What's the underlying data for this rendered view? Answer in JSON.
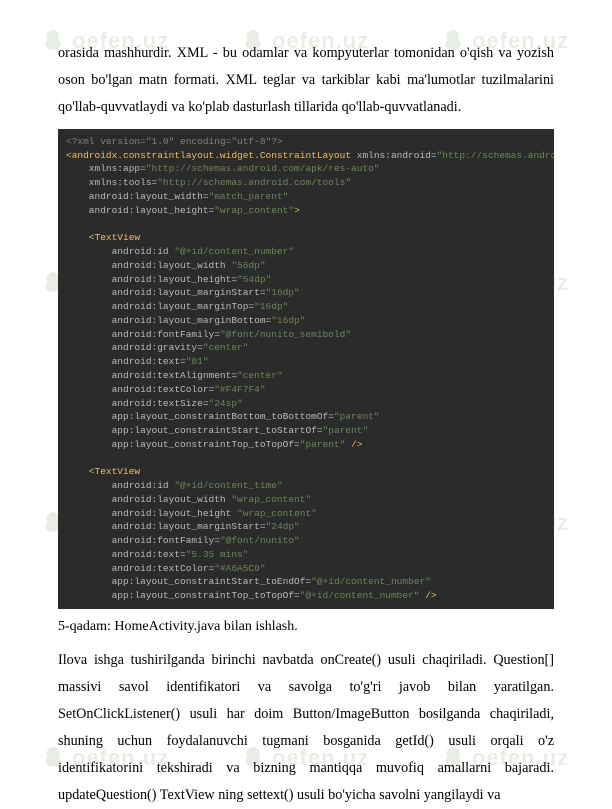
{
  "watermark_text": "oefen.uz",
  "intro_paragraph": "orasida mashhurdir. XML - bu odamlar va kompyuterlar tomonidan o'qish va yozish oson bo'lgan matn formati. XML teglar va tarkiblar kabi ma'lumotlar tuzilmalarini qo'llab-quvvatlaydi va ko'plab dasturlash tillarida qo'llab-quvvatlanadi.",
  "code": {
    "line1": "<?xml version=\"1.0\" encoding=\"utf-8\"?>",
    "line2a": "<androidx.constraintlayout.widget.ConstraintLayout",
    "line2b": " xmlns:android=",
    "line2c": "\"http://schemas.android.com/apk/res/android\"",
    "line3a": "    xmlns:app=",
    "line3b": "\"http://schemas.android.com/apk/res-auto\"",
    "line4a": "    xmlns:tools=",
    "line4b": "\"http://schemas.android.com/tools\"",
    "line5a": "    android:layout_width=",
    "line5b": "\"match_parent\"",
    "line6a": "    android:layout_height=",
    "line6b": "\"wrap_content\"",
    "line6c": ">",
    "blank": "",
    "line7": "    <TextView",
    "line8a": "        android:id ",
    "line8b": "\"@+id/content_number\"",
    "line9a": "        android:layout_width ",
    "line9b": "\"56dp\"",
    "line10a": "        android:layout_height=",
    "line10b": "\"54dp\"",
    "line11a": "        android:layout_marginStart=",
    "line11b": "\"16dp\"",
    "line12a": "        android:layout_marginTop=",
    "line12b": "\"16dp\"",
    "line13a": "        android:layout_marginBottom=",
    "line13b": "\"16dp\"",
    "line14a": "        android:fontFamily=",
    "line14b": "\"@font/nunito_semibold\"",
    "line15a": "        android:gravity=",
    "line15b": "\"center\"",
    "line16a": "        android:text=",
    "line16b": "\"01\"",
    "line17a": "        android:textAlignment=",
    "line17b": "\"center\"",
    "line18a": "        android:textColor=",
    "line18b": "\"#F4F7F4\"",
    "line19a": "        android:textSize=",
    "line19b": "\"24sp\"",
    "line20a": "        app:layout_constraintBottom_toBottomOf=",
    "line20b": "\"parent\"",
    "line21a": "        app:layout_constraintStart_toStartOf=",
    "line21b": "\"parent\"",
    "line22a": "        app:layout_constraintTop_toTopOf=",
    "line22b": "\"parent\"",
    "line22c": " />",
    "line23": "    <TextView",
    "line24a": "        android:id ",
    "line24b": "\"@+id/content_time\"",
    "line25a": "        android:layout_width ",
    "line25b": "\"wrap_content\"",
    "line26a": "        android:layout_height ",
    "line26b": "\"wrap_content\"",
    "line27a": "        android:layout_marginStart=",
    "line27b": "\"24dp\"",
    "line28a": "        android:fontFamily=",
    "line28b": "\"@font/nunito\"",
    "line29a": "        android:text=",
    "line29b": "\"5.35 mins\"",
    "line30a": "        android:textColor=",
    "line30b": "\"#A6A5C0\"",
    "line31a": "        app:layout_constraintStart_toEndOf=",
    "line31b": "\"@+id/content_number\"",
    "line32a": "        app:layout_constraintTop_toTopOf=",
    "line32b": "\"@+id/content_number\"",
    "line32c": " />"
  },
  "step_text": "5-qadam: HomeActivity.java bilan ishlash.",
  "body_paragraph": "Ilova ishga tushirilganda birinchi navbatda onCreate() usuli chaqiriladi. Question[] massivi savol identifikatori va savolga to'g'ri javob bilan yaratilgan. SetOnClickListener() usuli har doim Button/ImageButton bosilganda chaqiriladi, shuning uchun foydalanuvchi tugmani bosganida getId() usuli orqali o'z identifikatorini tekshiradi va bizning mantiqqa muvofiq amallarni bajaradi. updateQuestion() TextView ning settext() usuli bo'yicha savolni yangilaydi va"
}
